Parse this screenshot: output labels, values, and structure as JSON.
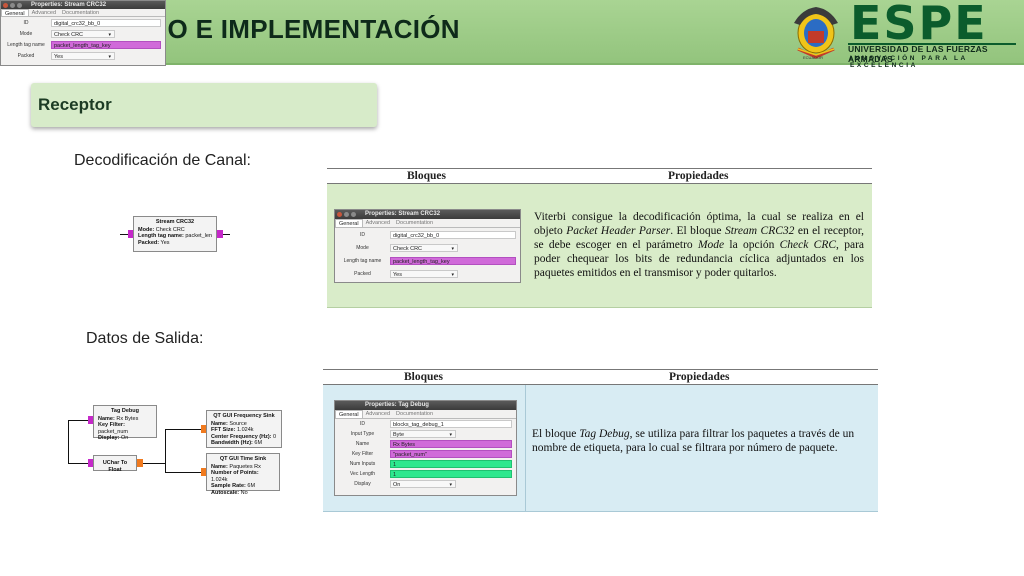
{
  "header": {
    "title": "IO E IMPLEMENTACIÓN",
    "brand_name": "ESPE",
    "brand_subtitle": "UNIVERSIDAD DE LAS FUERZAS ARMADAS",
    "brand_motto": "INNOVACIÓN PARA LA EXCELENCIA",
    "crest_caption": "ECUADOR"
  },
  "top_window": {
    "title": "Properties: Stream CRC32",
    "tabs": [
      "General",
      "Advanced",
      "Documentation"
    ],
    "rows": [
      {
        "label": "ID",
        "value": "digital_crc32_bb_0"
      },
      {
        "label": "Mode",
        "value": "Check CRC"
      },
      {
        "label": "Length tag name",
        "value": "packet_length_tag_key"
      },
      {
        "label": "Packed",
        "value": "Yes"
      }
    ]
  },
  "section": {
    "receptor": "Receptor",
    "channel_decoding": "Decodificación de Canal:",
    "output_data": "Datos de Salida:"
  },
  "flow1": {
    "block_title": "Stream CRC32",
    "lines": [
      {
        "k": "Mode:",
        "v": "Check CRC"
      },
      {
        "k": "Length tag name:",
        "v": "packet_len"
      },
      {
        "k": "Packed:",
        "v": "Yes"
      }
    ]
  },
  "table1": {
    "col_blocks": "Bloques",
    "col_props": "Propiedades",
    "window": {
      "title": "Properties: Stream CRC32",
      "tabs": [
        "General",
        "Advanced",
        "Documentation"
      ],
      "rows": [
        {
          "label": "ID",
          "value": "digital_crc32_bb_0"
        },
        {
          "label": "Mode",
          "value": "Check CRC"
        },
        {
          "label": "Length tag name",
          "value": "packet_length_tag_key"
        },
        {
          "label": "Packed",
          "value": "Yes"
        }
      ]
    },
    "description": {
      "p1": "Viterbi consigue la decodificación óptima, la cual se realiza en el objeto ",
      "i1": "Packet Header Parser",
      "p2": ". El bloque ",
      "i2": "Stream CRC32",
      "p3": " en el receptor, se debe escoger en el parámetro ",
      "i3": "Mode",
      "p4": " la opción ",
      "i4": "Check CRC",
      "p5": ", para poder chequear los bits de redundancia cíclica adjuntados en los paquetes emitidos en el transmisor y poder quitarlos."
    }
  },
  "flow2": {
    "tag_debug": {
      "title": "Tag Debug",
      "lines": [
        {
          "k": "Name:",
          "v": "Rx Bytes"
        },
        {
          "k": "Key Filter:",
          "v": "packet_num"
        },
        {
          "k": "Display:",
          "v": "On"
        }
      ]
    },
    "uchar": {
      "title": "UChar To Float"
    },
    "freq_sink": {
      "title": "QT GUI Frequency Sink",
      "lines": [
        {
          "k": "Name:",
          "v": "Source"
        },
        {
          "k": "FFT Size:",
          "v": "1.024k"
        },
        {
          "k": "Center Frequency (Hz):",
          "v": "0"
        },
        {
          "k": "Bandwidth (Hz):",
          "v": "6M"
        }
      ]
    },
    "time_sink": {
      "title": "QT GUI Time Sink",
      "lines": [
        {
          "k": "Name:",
          "v": "Paquetes Rx"
        },
        {
          "k": "Number of Points:",
          "v": "1.024k"
        },
        {
          "k": "Sample Rate:",
          "v": "6M"
        },
        {
          "k": "Autoscale:",
          "v": "No"
        }
      ]
    }
  },
  "table2": {
    "col_blocks": "Bloques",
    "col_props": "Propiedades",
    "window": {
      "title": "Properties: Tag Debug",
      "tabs": [
        "General",
        "Advanced",
        "Documentation"
      ],
      "rows": [
        {
          "label": "ID",
          "value": "blocks_tag_debug_1"
        },
        {
          "label": "Input Type",
          "value": "Byte"
        },
        {
          "label": "Name",
          "value": "Rx Bytes"
        },
        {
          "label": "Key Filter",
          "value": "\"packet_num\""
        },
        {
          "label": "Num Inputs",
          "value": "1"
        },
        {
          "label": "Vec Length",
          "value": "1"
        },
        {
          "label": "Display",
          "value": "On"
        }
      ]
    },
    "description": {
      "p1": "El bloque ",
      "i1": "Tag Debug",
      "p2": ", se utiliza para filtrar los paquetes a través de un nombre de etiqueta, para lo cual se filtrara por número de paquete."
    }
  },
  "colors": {
    "header_green": "#93c47d",
    "brand_green": "#0b5c2c",
    "table1_bg": "#d9ecc9",
    "table2_bg": "#d8ecf3",
    "port_purple": "#c529c9",
    "port_orange": "#f07a1f",
    "field_purple": "#d06ad9",
    "field_green": "#2ee88e"
  }
}
